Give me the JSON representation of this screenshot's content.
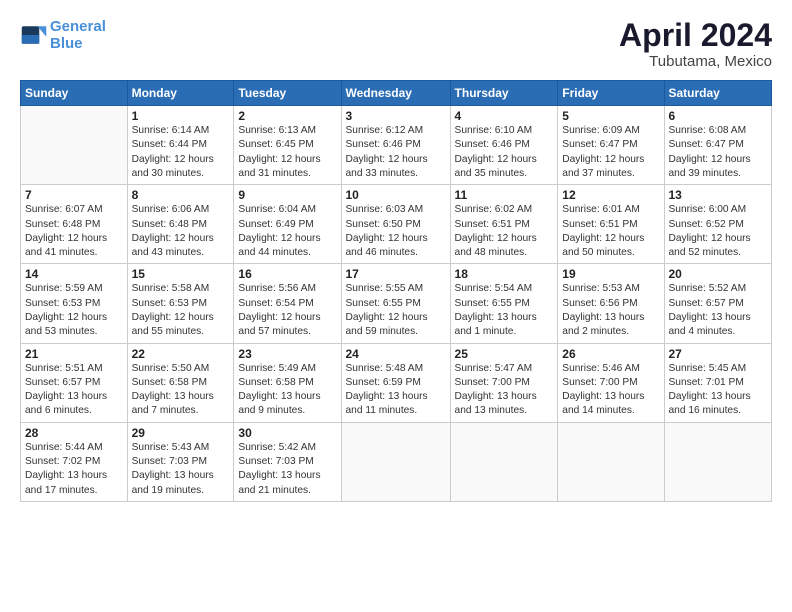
{
  "header": {
    "logo_line1": "General",
    "logo_line2": "Blue",
    "title": "April 2024",
    "subtitle": "Tubutama, Mexico"
  },
  "weekdays": [
    "Sunday",
    "Monday",
    "Tuesday",
    "Wednesday",
    "Thursday",
    "Friday",
    "Saturday"
  ],
  "weeks": [
    [
      {
        "day": "",
        "info": ""
      },
      {
        "day": "1",
        "info": "Sunrise: 6:14 AM\nSunset: 6:44 PM\nDaylight: 12 hours\nand 30 minutes."
      },
      {
        "day": "2",
        "info": "Sunrise: 6:13 AM\nSunset: 6:45 PM\nDaylight: 12 hours\nand 31 minutes."
      },
      {
        "day": "3",
        "info": "Sunrise: 6:12 AM\nSunset: 6:46 PM\nDaylight: 12 hours\nand 33 minutes."
      },
      {
        "day": "4",
        "info": "Sunrise: 6:10 AM\nSunset: 6:46 PM\nDaylight: 12 hours\nand 35 minutes."
      },
      {
        "day": "5",
        "info": "Sunrise: 6:09 AM\nSunset: 6:47 PM\nDaylight: 12 hours\nand 37 minutes."
      },
      {
        "day": "6",
        "info": "Sunrise: 6:08 AM\nSunset: 6:47 PM\nDaylight: 12 hours\nand 39 minutes."
      }
    ],
    [
      {
        "day": "7",
        "info": "Sunrise: 6:07 AM\nSunset: 6:48 PM\nDaylight: 12 hours\nand 41 minutes."
      },
      {
        "day": "8",
        "info": "Sunrise: 6:06 AM\nSunset: 6:48 PM\nDaylight: 12 hours\nand 43 minutes."
      },
      {
        "day": "9",
        "info": "Sunrise: 6:04 AM\nSunset: 6:49 PM\nDaylight: 12 hours\nand 44 minutes."
      },
      {
        "day": "10",
        "info": "Sunrise: 6:03 AM\nSunset: 6:50 PM\nDaylight: 12 hours\nand 46 minutes."
      },
      {
        "day": "11",
        "info": "Sunrise: 6:02 AM\nSunset: 6:51 PM\nDaylight: 12 hours\nand 48 minutes."
      },
      {
        "day": "12",
        "info": "Sunrise: 6:01 AM\nSunset: 6:51 PM\nDaylight: 12 hours\nand 50 minutes."
      },
      {
        "day": "13",
        "info": "Sunrise: 6:00 AM\nSunset: 6:52 PM\nDaylight: 12 hours\nand 52 minutes."
      }
    ],
    [
      {
        "day": "14",
        "info": "Sunrise: 5:59 AM\nSunset: 6:53 PM\nDaylight: 12 hours\nand 53 minutes."
      },
      {
        "day": "15",
        "info": "Sunrise: 5:58 AM\nSunset: 6:53 PM\nDaylight: 12 hours\nand 55 minutes."
      },
      {
        "day": "16",
        "info": "Sunrise: 5:56 AM\nSunset: 6:54 PM\nDaylight: 12 hours\nand 57 minutes."
      },
      {
        "day": "17",
        "info": "Sunrise: 5:55 AM\nSunset: 6:55 PM\nDaylight: 12 hours\nand 59 minutes."
      },
      {
        "day": "18",
        "info": "Sunrise: 5:54 AM\nSunset: 6:55 PM\nDaylight: 13 hours\nand 1 minute."
      },
      {
        "day": "19",
        "info": "Sunrise: 5:53 AM\nSunset: 6:56 PM\nDaylight: 13 hours\nand 2 minutes."
      },
      {
        "day": "20",
        "info": "Sunrise: 5:52 AM\nSunset: 6:57 PM\nDaylight: 13 hours\nand 4 minutes."
      }
    ],
    [
      {
        "day": "21",
        "info": "Sunrise: 5:51 AM\nSunset: 6:57 PM\nDaylight: 13 hours\nand 6 minutes."
      },
      {
        "day": "22",
        "info": "Sunrise: 5:50 AM\nSunset: 6:58 PM\nDaylight: 13 hours\nand 7 minutes."
      },
      {
        "day": "23",
        "info": "Sunrise: 5:49 AM\nSunset: 6:58 PM\nDaylight: 13 hours\nand 9 minutes."
      },
      {
        "day": "24",
        "info": "Sunrise: 5:48 AM\nSunset: 6:59 PM\nDaylight: 13 hours\nand 11 minutes."
      },
      {
        "day": "25",
        "info": "Sunrise: 5:47 AM\nSunset: 7:00 PM\nDaylight: 13 hours\nand 13 minutes."
      },
      {
        "day": "26",
        "info": "Sunrise: 5:46 AM\nSunset: 7:00 PM\nDaylight: 13 hours\nand 14 minutes."
      },
      {
        "day": "27",
        "info": "Sunrise: 5:45 AM\nSunset: 7:01 PM\nDaylight: 13 hours\nand 16 minutes."
      }
    ],
    [
      {
        "day": "28",
        "info": "Sunrise: 5:44 AM\nSunset: 7:02 PM\nDaylight: 13 hours\nand 17 minutes."
      },
      {
        "day": "29",
        "info": "Sunrise: 5:43 AM\nSunset: 7:03 PM\nDaylight: 13 hours\nand 19 minutes."
      },
      {
        "day": "30",
        "info": "Sunrise: 5:42 AM\nSunset: 7:03 PM\nDaylight: 13 hours\nand 21 minutes."
      },
      {
        "day": "",
        "info": ""
      },
      {
        "day": "",
        "info": ""
      },
      {
        "day": "",
        "info": ""
      },
      {
        "day": "",
        "info": ""
      }
    ]
  ]
}
